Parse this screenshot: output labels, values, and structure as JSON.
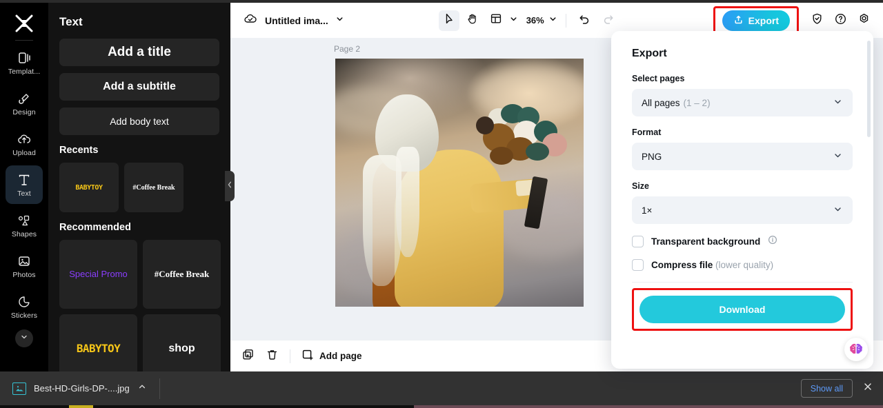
{
  "rail": {
    "logo_icon": "capcut-logo-icon",
    "items": [
      {
        "label": "Templat...",
        "icon": "template-icon",
        "active": false
      },
      {
        "label": "Design",
        "icon": "design-icon",
        "active": false
      },
      {
        "label": "Upload",
        "icon": "upload-cloud-icon",
        "active": false
      },
      {
        "label": "Text",
        "icon": "text-t-icon",
        "active": true
      },
      {
        "label": "Shapes",
        "icon": "shapes-icon",
        "active": false
      },
      {
        "label": "Photos",
        "icon": "photo-image-icon",
        "active": false
      },
      {
        "label": "Stickers",
        "icon": "sticker-icon",
        "active": false
      }
    ],
    "more_icon": "chevron-down-icon"
  },
  "panel": {
    "title": "Text",
    "buttons": [
      {
        "label": "Add a title"
      },
      {
        "label": "Add a subtitle"
      },
      {
        "label": "Add body text"
      }
    ],
    "recents_heading": "Recents",
    "recents": [
      {
        "label": "BABYTOY"
      },
      {
        "label": "#Coffee Break"
      }
    ],
    "recommended_heading": "Recommended",
    "recommended": [
      {
        "label": "Special Promo"
      },
      {
        "label": "#Coffee Break"
      },
      {
        "label": "BABYTOY"
      },
      {
        "label": "shop"
      }
    ],
    "collapse_icon": "chevron-left-icon"
  },
  "toolbar": {
    "cloud_icon": "cloud-saved-icon",
    "doc_title": "Untitled ima...",
    "title_chevron_icon": "chevron-down-icon",
    "select_tool_icon": "cursor-arrow-icon",
    "hand_tool_icon": "hand-pan-icon",
    "layout_tool_icon": "layout-grid-icon",
    "layout_chevron_icon": "chevron-down-icon",
    "zoom_value": "36%",
    "zoom_chevron_icon": "chevron-down-icon",
    "undo_icon": "undo-arrow-icon",
    "redo_icon": "redo-arrow-icon",
    "export_label": "Export",
    "export_icon": "export-upload-icon",
    "shield_icon": "shield-check-icon",
    "help_icon": "question-circle-icon",
    "settings_icon": "gear-icon"
  },
  "canvas": {
    "page_label": "Page 2",
    "duplicate_page_icon": "duplicate-page-icon",
    "more_icon": "ellipsis-icon",
    "artwork_alt": "woman-in-yellow-coat-holding-bouquet"
  },
  "page_footer": {
    "duplicate_icon": "duplicate-icon",
    "delete_icon": "trash-icon",
    "add_page_label": "Add page",
    "add_page_icon": "add-page-icon"
  },
  "export_panel": {
    "title": "Export",
    "select_pages_label": "Select pages",
    "select_pages_value": "All pages",
    "select_pages_range": "(1 – 2)",
    "format_label": "Format",
    "format_value": "PNG",
    "size_label": "Size",
    "size_value": "1×",
    "chevron_icon": "chevron-down-icon",
    "transparent_label": "Transparent background",
    "transparent_info_icon": "info-circle-icon",
    "transparent_checked": false,
    "compress_label": "Compress file",
    "compress_note": "(lower quality)",
    "compress_checked": false,
    "download_label": "Download",
    "brain_icon": "ai-brain-icon",
    "scrollbar_icon": "vertical-scrollbar"
  },
  "download_bar": {
    "file_icon": "image-file-icon",
    "file_name": "Best-HD-Girls-DP-....jpg",
    "expand_icon": "chevron-up-icon",
    "show_all_label": "Show all",
    "close_icon": "close-x-icon"
  },
  "colors": {
    "accent_cyan": "#23c9dc",
    "export_gradient_start": "#2b9cf5",
    "export_gradient_end": "#13cbe0",
    "highlight_red": "#ee1111",
    "panel_bg": "#131313",
    "rail_bg": "#000000",
    "canvas_bg": "#eef1f5",
    "active_rail": "#1b2733",
    "link_blue": "#5e9bfa"
  }
}
